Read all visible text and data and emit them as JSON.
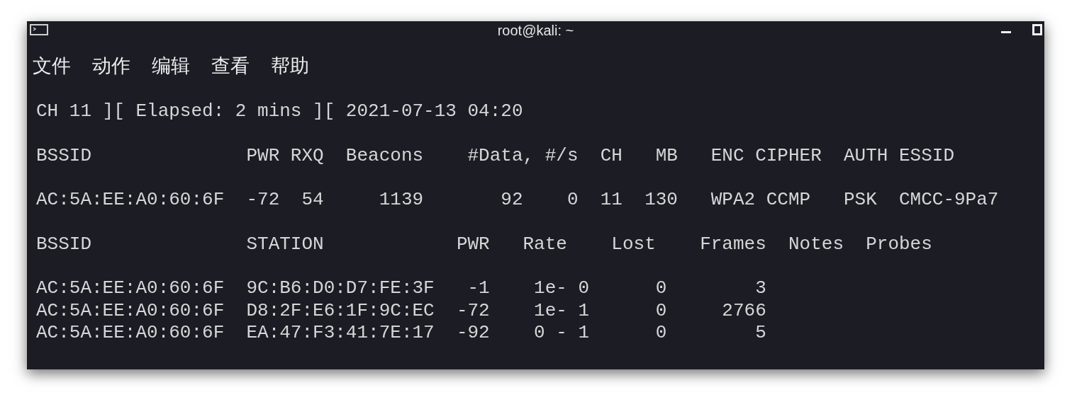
{
  "window": {
    "title": "root@kali: ~"
  },
  "menu": [
    "文件",
    "动作",
    "编辑",
    "查看",
    "帮助"
  ],
  "terminal": {
    "blocks": [
      [
        "CH 11 ][ Elapsed: 2 mins ][ 2021-07-13 04:20"
      ],
      [
        "BSSID              PWR RXQ  Beacons    #Data, #/s  CH   MB   ENC CIPHER  AUTH ESSID"
      ],
      [
        "AC:5A:EE:A0:60:6F  -72  54     1139       92    0  11  130   WPA2 CCMP   PSK  CMCC-9Pa7"
      ],
      [
        "BSSID              STATION            PWR   Rate    Lost    Frames  Notes  Probes"
      ],
      [
        "AC:5A:EE:A0:60:6F  9C:B6:D0:D7:FE:3F   -1    1e- 0      0        3",
        "AC:5A:EE:A0:60:6F  D8:2F:E6:1F:9C:EC  -72    1e- 1      0     2766",
        "AC:5A:EE:A0:60:6F  EA:47:F3:41:7E:17  -92    0 - 1      0        5"
      ]
    ]
  }
}
